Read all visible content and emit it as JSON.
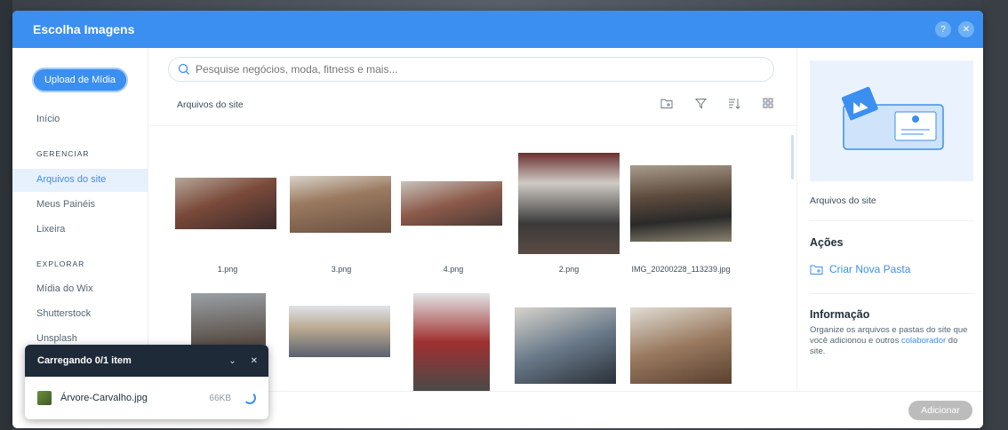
{
  "dialog": {
    "title": "Escolha Imagens",
    "help_icon": "question-icon",
    "close_icon": "close-icon",
    "help_label": "?",
    "close_label": "✕"
  },
  "sidebar": {
    "upload_label": "Upload de Mídia",
    "home_label": "Início",
    "manage_section": "GERENCIAR",
    "manage_items": [
      "Arquivos do site",
      "Meus Painéis",
      "Lixeira"
    ],
    "explore_section": "EXPLORAR",
    "explore_items": [
      "Mídia do Wix",
      "Shutterstock",
      "Unsplash"
    ]
  },
  "main": {
    "search_placeholder": "Pesquise negócios, moda, fitness e mais...",
    "breadcrumb": "Arquivos do site",
    "tools": [
      "new-folder-icon",
      "filter-icon",
      "sort-icon",
      "grid-view-icon"
    ],
    "files_row1": [
      "1.png",
      "3.png",
      "4.png",
      "2.png",
      "IMG_20200228_113239.jpg"
    ],
    "thumb_colors": [
      "#7a4a3a",
      "#6a5040",
      "#8c5a4a",
      "#5a4a44",
      "#6a3030",
      "#5c4a3c",
      "#8a8270",
      "#5a6070",
      "#6a7a8a",
      "#9a7a60"
    ]
  },
  "right_panel": {
    "title": "Arquivos do site",
    "actions_heading": "Ações",
    "new_folder_label": "Criar Nova Pasta",
    "info_heading": "Informação",
    "info_text_1": "Organize os arquivos e pastas do site que você adicionou e outros ",
    "info_link": "colaborador",
    "info_text_2": " do site."
  },
  "footer": {
    "add_label": "Adicionar"
  },
  "upload_toast": {
    "title": "Carregando 0/1 item",
    "minimize_label": "⌄",
    "close_label": "✕",
    "file_name": "Árvore-Carvalho.jpg",
    "file_size": "66KB"
  },
  "colors": {
    "accent": "#3b8ff0",
    "toast_header": "#1e2a38",
    "disabled_button": "#bcbcbc"
  }
}
